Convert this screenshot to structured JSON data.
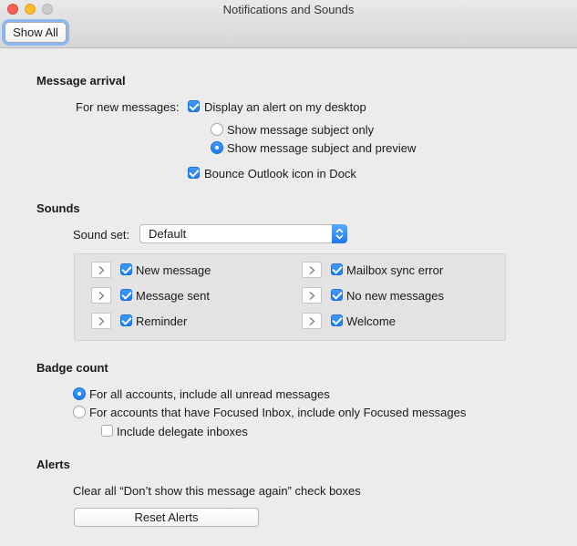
{
  "window": {
    "title": "Notifications and Sounds",
    "show_all": "Show All"
  },
  "message_arrival": {
    "heading": "Message arrival",
    "for_new_label": "For new messages:",
    "display_alert": "Display an alert on my desktop",
    "subject_only": "Show message subject only",
    "subject_preview": "Show message subject and preview",
    "bounce_icon": "Bounce Outlook icon in Dock"
  },
  "sounds": {
    "heading": "Sounds",
    "sound_set_label": "Sound set:",
    "sound_set_value": "Default",
    "items": [
      {
        "label": "New message"
      },
      {
        "label": "Message sent"
      },
      {
        "label": "Reminder"
      },
      {
        "label": "Mailbox sync error"
      },
      {
        "label": "No new messages"
      },
      {
        "label": "Welcome"
      }
    ]
  },
  "badge": {
    "heading": "Badge count",
    "all_accounts": "For all accounts, include all unread messages",
    "focused_accounts": "For accounts that have Focused Inbox, include only Focused messages",
    "delegate": "Include delegate inboxes"
  },
  "alerts": {
    "heading": "Alerts",
    "description": "Clear all “Don’t show this message again” check boxes",
    "reset_button": "Reset Alerts"
  }
}
